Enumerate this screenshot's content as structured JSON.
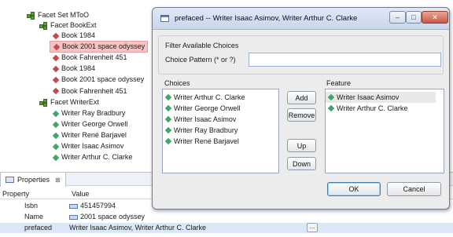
{
  "tree": {
    "facet_set": "Facet Set MToO",
    "facet_book": "Facet BookExt",
    "books": [
      "Book 1984",
      "Book 2001 space odyssey",
      "Book Fahrenheit 451",
      "Book 1984",
      "Book 2001 space odyssey",
      "Book Fahrenheit 451"
    ],
    "facet_writer": "Facet WriterExt",
    "writers": [
      "Writer Ray Bradbury",
      "Writer George Orwell",
      "Writer René Barjavel",
      "Writer Isaac Asimov",
      "Writer Arthur C. Clarke"
    ],
    "selected_index": 1
  },
  "properties": {
    "tab_label": "Properties",
    "tab_close": "⊠",
    "col_property": "Property",
    "col_value": "Value",
    "rows": [
      {
        "key": "Isbn",
        "value": "451457994",
        "icon": "property-icon"
      },
      {
        "key": "Name",
        "value": "2001 space odyssey",
        "icon": "property-icon"
      },
      {
        "key": "prefaced",
        "value": "Writer Isaac Asimov, Writer Arthur C. Clarke"
      }
    ],
    "edit_button": "..."
  },
  "dialog": {
    "title": "prefaced -- Writer Isaac Asimov, Writer Arthur C. Clarke",
    "min_label": "–",
    "max_label": "□",
    "close_label": "✕",
    "filter_title": "Filter Available Choices",
    "pattern_label": "Choice Pattern (* or ?)",
    "pattern_value": "",
    "choices_label": "Choices",
    "feature_label": "Feature",
    "choices": [
      "Writer Arthur C. Clarke",
      "Writer George Orwell",
      "Writer Isaac Asimov",
      "Writer Ray Bradbury",
      "Writer René Barjavel"
    ],
    "feature": [
      "Writer Isaac Asimov",
      "Writer Arthur C. Clarke"
    ],
    "buttons": {
      "add": "Add",
      "remove": "Remove",
      "up": "Up",
      "down": "Down",
      "ok": "OK",
      "cancel": "Cancel"
    }
  },
  "colors": {
    "red_marker": "#c7474b",
    "green_marker": "#3fa66a",
    "selection": "#f5c3c3"
  }
}
